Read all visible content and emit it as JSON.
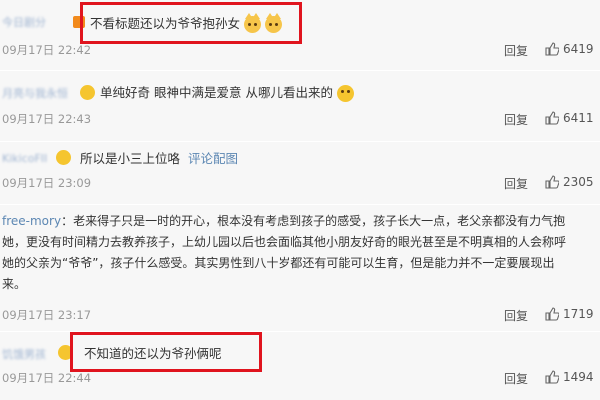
{
  "comments": [
    {
      "user": "今日剧分",
      "text": "不看标题还以为爷爷抱孙女",
      "time": "09月17日 22:42",
      "reply": "回复",
      "likes": "6419"
    },
    {
      "user": "月亮与我永恒",
      "text": "单纯好奇 眼神中满是爱意 从哪儿看出来的",
      "time": "09月17日 22:43",
      "reply": "回复",
      "likes": "6411"
    },
    {
      "user": "KikicoFII",
      "text": "所以是小三上位咯",
      "link": "评论配图",
      "time": "09月17日 23:09",
      "reply": "回复",
      "likes": "2305"
    },
    {
      "user": "free-mory",
      "text_lines": [
        "：老来得子只是一时的开心，根本没有考虑到孩子的感受，孩子长大一点，老父亲都没有力气抱",
        "她，更没有时间精力去教养孩子，上幼儿园以后也会面临其他小朋友好奇的眼光甚至是不明真相的人会称呼",
        "她的父亲为“爷爷”，孩子什么感受。其实男性到八十岁都还有可能可以生育，但是能力并不一定要展现出",
        "来。"
      ],
      "time": "09月17日 23:17",
      "reply": "回复",
      "likes": "1719"
    },
    {
      "user": "饥饿男孩",
      "text": "不知道的还以为爷孙俩呢",
      "time": "09月17日 22:44",
      "reply": "回复",
      "likes": "1494"
    }
  ],
  "colors": {
    "highlight": "#e0141e",
    "username": "#8aa4c8",
    "link": "#5c87b3"
  }
}
